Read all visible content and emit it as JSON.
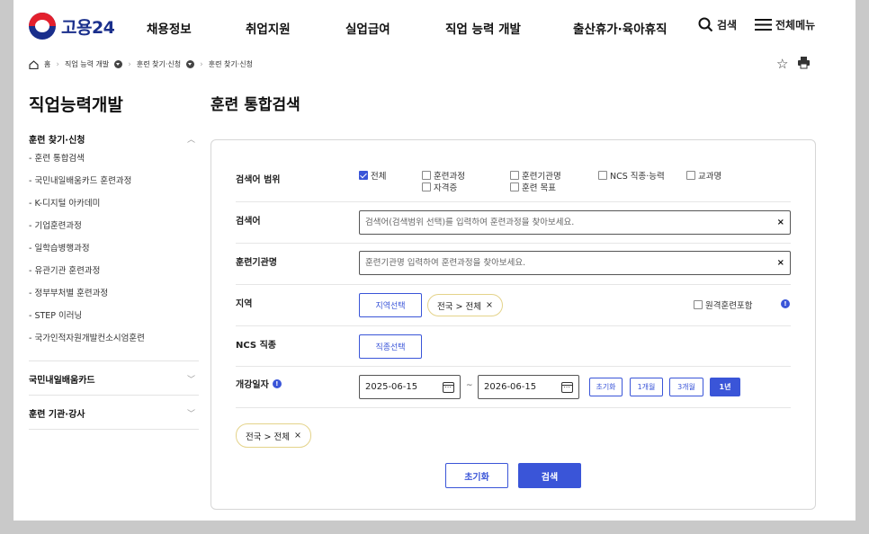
{
  "header": {
    "logo_text": "고용24",
    "menu": [
      "채용정보",
      "취업지원",
      "실업급여",
      "직업 능력 개발",
      "출산휴가·육아휴직"
    ],
    "search_label": "검색",
    "all_menu_label": "전체메뉴"
  },
  "breadcrumb": {
    "home": "홈",
    "items": [
      "직업 능력 개발",
      "훈련 찾기·신청",
      "훈련 찾기·신청"
    ]
  },
  "sidebar": {
    "title": "직업능력개발",
    "groups": [
      {
        "label": "훈련 찾기·신청",
        "expanded": true,
        "items": [
          "- 훈련 통합검색",
          "- 국민내일배움카드 훈련과정",
          "- K-디지털 아카데미",
          "- 기업훈련과정",
          "- 일학습병행과정",
          "- 유관기관 훈련과정",
          "- 정부부처별 훈련과정",
          "- STEP 이러닝",
          "- 국가인적자원개발컨소시엄훈련"
        ]
      },
      {
        "label": "국민내일배움카드",
        "expanded": false
      },
      {
        "label": "훈련 기관·강사",
        "expanded": false
      }
    ]
  },
  "main": {
    "title": "훈련 통합검색",
    "scope": {
      "label": "검색어 범위",
      "options": [
        {
          "label": "전체",
          "checked": true
        },
        {
          "label": "훈련과정",
          "checked": false
        },
        {
          "label": "자격증",
          "checked": false
        },
        {
          "label": "훈련기관명",
          "checked": false
        },
        {
          "label": "훈련 목표",
          "checked": false
        },
        {
          "label": "NCS 직종·능력",
          "checked": false
        },
        {
          "label": "교과명",
          "checked": false
        }
      ]
    },
    "keyword": {
      "label": "검색어",
      "placeholder": "검색어(검색범위 선택)를 입력하여 훈련과정을 찾아보세요.",
      "value": ""
    },
    "institution": {
      "label": "훈련기관명",
      "placeholder": "훈련기관명 입력하여 훈련과정을 찾아보세요.",
      "value": ""
    },
    "region": {
      "label": "지역",
      "select_button": "지역선택",
      "chip": "전국 > 전체",
      "remote_label": "원격훈련포함",
      "remote_checked": false
    },
    "ncs": {
      "label": "NCS 직종",
      "select_button": "직종선택"
    },
    "period": {
      "label": "개강일자",
      "start": "2025-06-15",
      "separator": "~",
      "end": "2026-06-15",
      "presets": [
        "초기화",
        "1개월",
        "3개월",
        "1년"
      ],
      "active_preset": "1년"
    },
    "selected_chip": "전국 > 전체",
    "buttons": {
      "reset": "초기화",
      "search": "검색"
    }
  },
  "colors": {
    "accent": "#3a55d8",
    "logo_blue": "#1a2f8c",
    "logo_red": "#e3202d",
    "chip_border": "#e4d38a"
  }
}
